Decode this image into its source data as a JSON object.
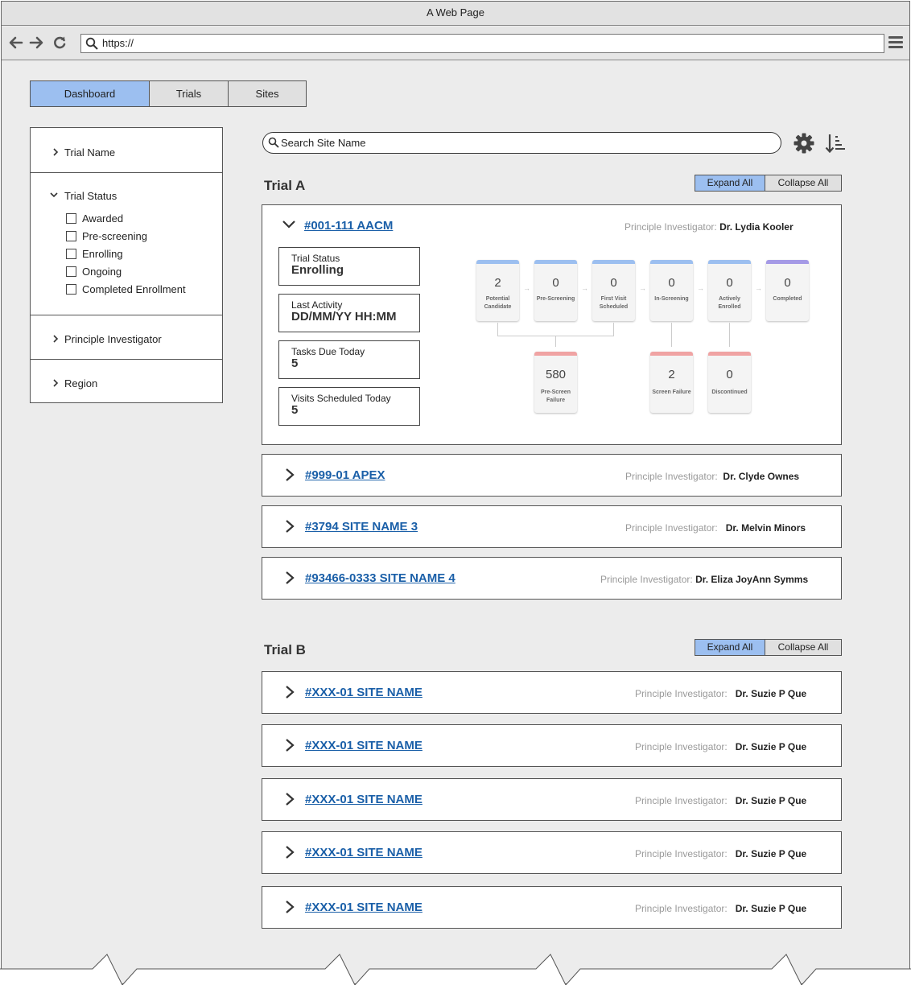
{
  "browser": {
    "title": "A Web Page",
    "url": "https://"
  },
  "tabs": [
    {
      "label": "Dashboard",
      "active": true
    },
    {
      "label": "Trials",
      "active": false
    },
    {
      "label": "Sites",
      "active": false
    }
  ],
  "filters": {
    "trial_name": "Trial Name",
    "trial_status": "Trial Status",
    "status_options": [
      "Awarded",
      "Pre-screening",
      "Enrolling",
      "Ongoing",
      "Completed Enrollment"
    ],
    "principle_investigator": "Principle Investigator",
    "region": "Region"
  },
  "search": {
    "placeholder": "Search Site Name"
  },
  "segmented": {
    "expand": "Expand All",
    "collapse": "Collapse All"
  },
  "pi_label": "Principle Investigator:",
  "trial_a": {
    "title": "Trial A",
    "expanded_site": {
      "id": "#001-111 AACM",
      "pi": "Dr. Lydia Kooler",
      "info": [
        {
          "label": "Trial Status",
          "value": "Enrolling"
        },
        {
          "label": "Last Activity",
          "value": "DD/MM/YY HH:MM"
        },
        {
          "label": "Tasks Due Today",
          "value": "5"
        },
        {
          "label": "Visits Scheduled Today",
          "value": "5"
        }
      ],
      "stages": [
        {
          "value": "2",
          "caption": "Potential Candidate",
          "color": "#9cbff0"
        },
        {
          "value": "0",
          "caption": "Pre-Screening",
          "color": "#9cbff0"
        },
        {
          "value": "0",
          "caption": "First Visit Scheduled",
          "color": "#9cbff0"
        },
        {
          "value": "0",
          "caption": "In-Screening",
          "color": "#9cbff0"
        },
        {
          "value": "0",
          "caption": "Actively Enrolled",
          "color": "#9cbff0"
        },
        {
          "value": "0",
          "caption": "Completed",
          "color": "#a59ae6"
        }
      ],
      "failures": [
        {
          "value": "580",
          "caption": "Pre-Screen Failure",
          "color": "#f0a3a3"
        },
        {
          "value": "2",
          "caption": "Screen Failure",
          "color": "#f0a3a3"
        },
        {
          "value": "0",
          "caption": "Discontinued",
          "color": "#f0a3a3"
        }
      ]
    },
    "sites": [
      {
        "id": "#999-01 APEX",
        "pi": "Dr. Clyde Ownes"
      },
      {
        "id": "#3794 SITE NAME 3",
        "pi": "Dr. Melvin Minors"
      },
      {
        "id": "#93466-0333 SITE NAME 4",
        "pi": "Dr. Eliza JoyAnn Symms"
      }
    ]
  },
  "trial_b": {
    "title": "Trial B",
    "sites": [
      {
        "id": "#XXX-01 SITE NAME",
        "pi": "Dr. Suzie P Que"
      },
      {
        "id": "#XXX-01 SITE NAME",
        "pi": "Dr. Suzie P Que"
      },
      {
        "id": "#XXX-01 SITE NAME",
        "pi": "Dr. Suzie P Que"
      },
      {
        "id": "#XXX-01 SITE NAME",
        "pi": "Dr. Suzie P Que"
      },
      {
        "id": "#XXX-01 SITE NAME",
        "pi": "Dr. Suzie P Que"
      }
    ]
  }
}
